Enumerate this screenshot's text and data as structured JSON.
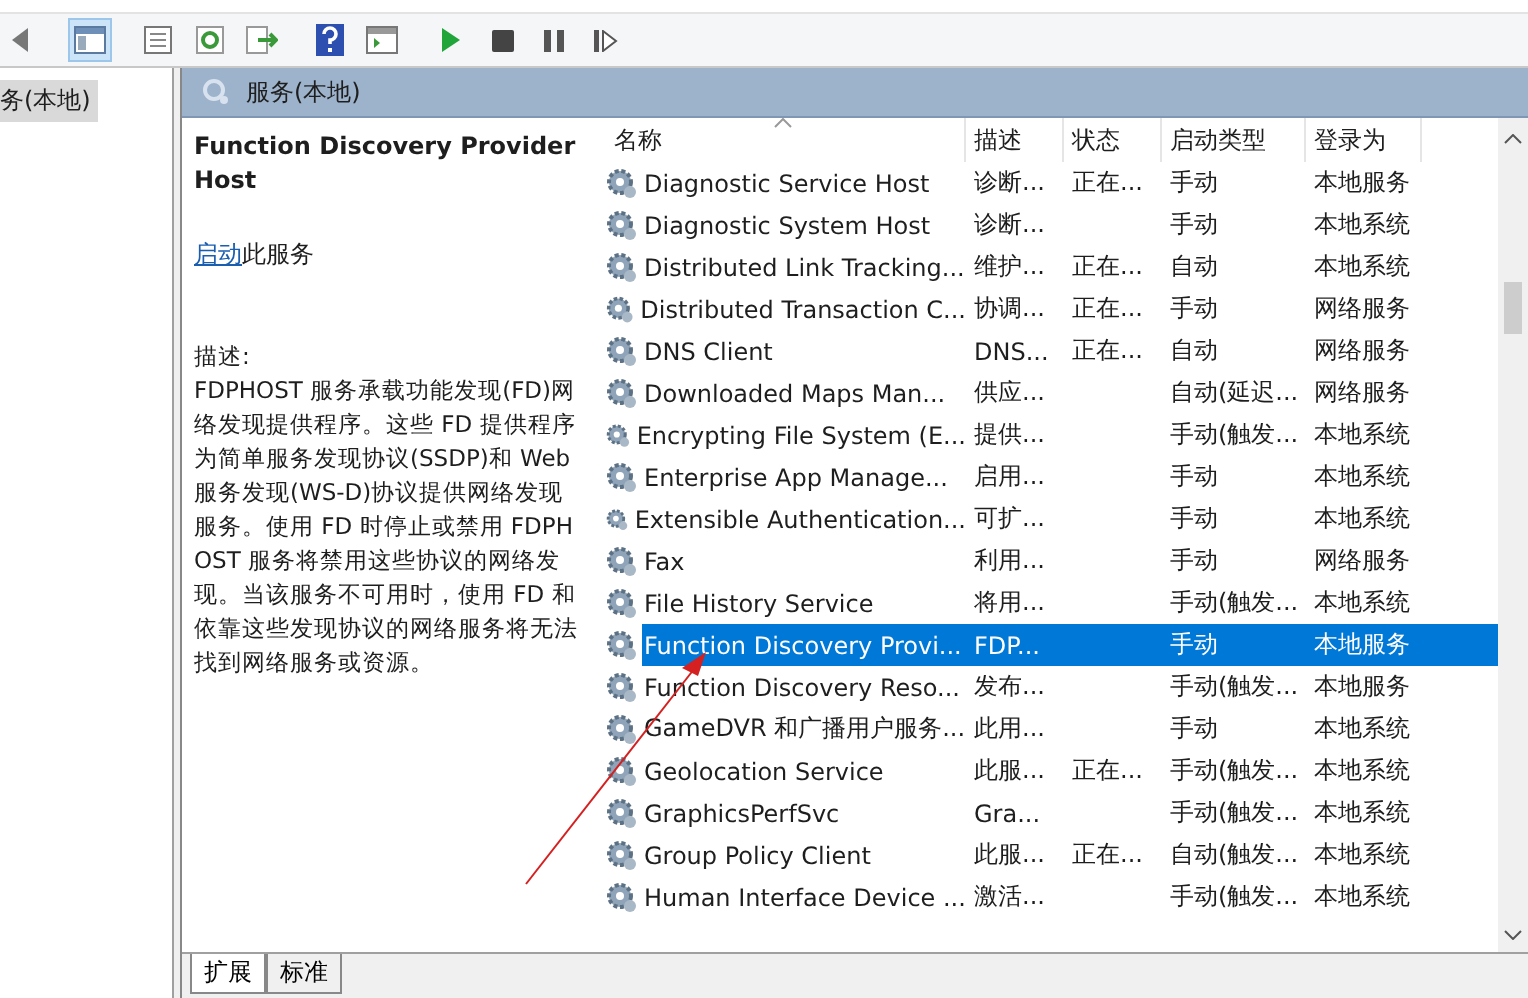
{
  "toolbar": {
    "buttons": [
      {
        "kind": "back",
        "selected": false
      },
      {
        "kind": "tree",
        "selected": true
      },
      {
        "kind": "properties",
        "selected": false
      },
      {
        "kind": "refresh",
        "selected": false
      },
      {
        "kind": "export",
        "selected": false
      },
      {
        "kind": "help",
        "selected": false
      },
      {
        "kind": "console",
        "selected": false
      },
      {
        "kind": "play",
        "selected": false
      },
      {
        "kind": "stop",
        "selected": false
      },
      {
        "kind": "pause",
        "selected": false
      },
      {
        "kind": "resume",
        "selected": false
      }
    ]
  },
  "tree": {
    "items": [
      {
        "label": "务(本地)",
        "selected": true
      }
    ]
  },
  "panel": {
    "title": "服务(本地)"
  },
  "details": {
    "service_name": "Function Discovery Provider Host",
    "action_link": "启动",
    "action_text": "此服务",
    "description_label": "描述:",
    "description": "FDPHOST 服务承载功能发现(FD)网络发现提供程序。这些 FD 提供程序为简单服务发现协议(SSDP)和 Web 服务发现(WS-D)协议提供网络发现服务。使用 FD 时停止或禁用 FDPHOST 服务将禁用这些协议的网络发现。当该服务不可用时，使用 FD 和依靠这些发现协议的网络服务将无法找到网络服务或资源。"
  },
  "table": {
    "columns": [
      "名称",
      "描述",
      "状态",
      "启动类型",
      "登录为"
    ],
    "rows": [
      {
        "name": "Diagnostic Service Host",
        "description": "诊断...",
        "status": "正在...",
        "startup": "手动",
        "logon": "本地服务",
        "selected": false
      },
      {
        "name": "Diagnostic System Host",
        "description": "诊断...",
        "status": "",
        "startup": "手动",
        "logon": "本地系统",
        "selected": false
      },
      {
        "name": "Distributed Link Tracking...",
        "description": "维护...",
        "status": "正在...",
        "startup": "自动",
        "logon": "本地系统",
        "selected": false
      },
      {
        "name": "Distributed Transaction C...",
        "description": "协调...",
        "status": "正在...",
        "startup": "手动",
        "logon": "网络服务",
        "selected": false
      },
      {
        "name": "DNS Client",
        "description": "DNS...",
        "status": "正在...",
        "startup": "自动",
        "logon": "网络服务",
        "selected": false
      },
      {
        "name": "Downloaded Maps Man...",
        "description": "供应...",
        "status": "",
        "startup": "自动(延迟...",
        "logon": "网络服务",
        "selected": false
      },
      {
        "name": "Encrypting File System (E...",
        "description": "提供...",
        "status": "",
        "startup": "手动(触发...",
        "logon": "本地系统",
        "selected": false
      },
      {
        "name": "Enterprise App Manage...",
        "description": "启用...",
        "status": "",
        "startup": "手动",
        "logon": "本地系统",
        "selected": false
      },
      {
        "name": "Extensible Authentication...",
        "description": "可扩...",
        "status": "",
        "startup": "手动",
        "logon": "本地系统",
        "selected": false
      },
      {
        "name": "Fax",
        "description": "利用...",
        "status": "",
        "startup": "手动",
        "logon": "网络服务",
        "selected": false
      },
      {
        "name": "File History Service",
        "description": "将用...",
        "status": "",
        "startup": "手动(触发...",
        "logon": "本地系统",
        "selected": false
      },
      {
        "name": "Function Discovery Provi...",
        "description": "FDP...",
        "status": "",
        "startup": "手动",
        "logon": "本地服务",
        "selected": true
      },
      {
        "name": "Function Discovery Reso...",
        "description": "发布...",
        "status": "",
        "startup": "手动(触发...",
        "logon": "本地服务",
        "selected": false
      },
      {
        "name": "GameDVR 和广播用户服务...",
        "description": "此用...",
        "status": "",
        "startup": "手动",
        "logon": "本地系统",
        "selected": false
      },
      {
        "name": "Geolocation Service",
        "description": "此服...",
        "status": "正在...",
        "startup": "手动(触发...",
        "logon": "本地系统",
        "selected": false
      },
      {
        "name": "GraphicsPerfSvc",
        "description": "Gra...",
        "status": "",
        "startup": "手动(触发...",
        "logon": "本地系统",
        "selected": false
      },
      {
        "name": "Group Policy Client",
        "description": "此服...",
        "status": "正在...",
        "startup": "自动(触发...",
        "logon": "本地系统",
        "selected": false
      },
      {
        "name": "Human Interface Device ...",
        "description": "激活...",
        "status": "",
        "startup": "手动(触发...",
        "logon": "本地系统",
        "selected": false
      }
    ]
  },
  "bottom_tabs": [
    {
      "label": "扩展",
      "selected": true
    },
    {
      "label": "标准",
      "selected": false
    }
  ]
}
